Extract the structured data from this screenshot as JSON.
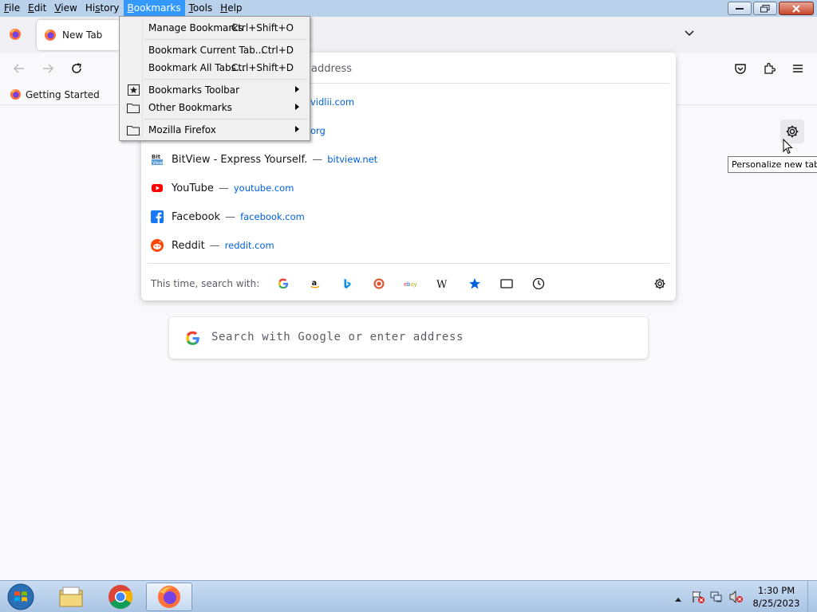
{
  "menubar": {
    "items": [
      {
        "label": "File",
        "accel": "F",
        "rest": "ile"
      },
      {
        "label": "Edit",
        "accel": "E",
        "rest": "dit"
      },
      {
        "label": "View",
        "accel": "V",
        "rest": "iew"
      },
      {
        "label": "History",
        "pre": "Hi",
        "accel": "s",
        "rest": "tory"
      },
      {
        "label": "Bookmarks",
        "accel": "B",
        "rest": "ookmarks"
      },
      {
        "label": "Tools",
        "accel": "T",
        "rest": "ools"
      },
      {
        "label": "Help",
        "accel": "H",
        "rest": "elp"
      }
    ]
  },
  "tabs": [
    {
      "label": "New Tab"
    }
  ],
  "bookmarks_bar": {
    "items": [
      {
        "label": "Getting Started"
      }
    ]
  },
  "urlbar": {
    "input_partial": "address",
    "results": [
      {
        "title": "",
        "url": "vidlii.com"
      },
      {
        "title": "",
        "url": "org"
      },
      {
        "title": "BitView - Express Yourself.",
        "url": "bitview.net",
        "icon": "bitview-icon"
      },
      {
        "title": "YouTube",
        "url": "youtube.com",
        "icon": "youtube-icon"
      },
      {
        "title": "Facebook",
        "url": "facebook.com",
        "icon": "facebook-icon"
      },
      {
        "title": "Reddit",
        "url": "reddit.com",
        "icon": "reddit-icon"
      }
    ],
    "separator": "—",
    "oneoff_label": "This time, search with:",
    "engines": [
      "google-icon",
      "amazon-icon",
      "bing-icon",
      "duckduckgo-icon",
      "ebay-icon",
      "wikipedia-icon",
      "bookmarks-star-icon",
      "tabs-icon",
      "history-icon"
    ]
  },
  "bookmarks_menu": {
    "items": [
      {
        "label": "Manage Bookmarks",
        "shortcut": "Ctrl+Shift+O"
      },
      {
        "label": "Bookmark Current Tab...",
        "shortcut": "Ctrl+D"
      },
      {
        "label": "Bookmark All Tabs...",
        "shortcut": "Ctrl+Shift+D"
      },
      {
        "label": "Bookmarks Toolbar",
        "submenu": true
      },
      {
        "label": "Other Bookmarks",
        "submenu": true
      },
      {
        "label": "Mozilla Firefox",
        "submenu": true
      }
    ]
  },
  "tooltip": "Personalize new tab",
  "content_search": {
    "placeholder": "Search with Google or enter address"
  },
  "taskbar": {
    "apps": [
      "windows-explorer",
      "google-chrome",
      "firefox"
    ],
    "clock_time": "1:30 PM",
    "clock_date": "8/25/2023"
  },
  "colors": {
    "accent": "#0061e0",
    "menu_highlight": "#3399ff",
    "titlebar": "#b9d1ea"
  }
}
